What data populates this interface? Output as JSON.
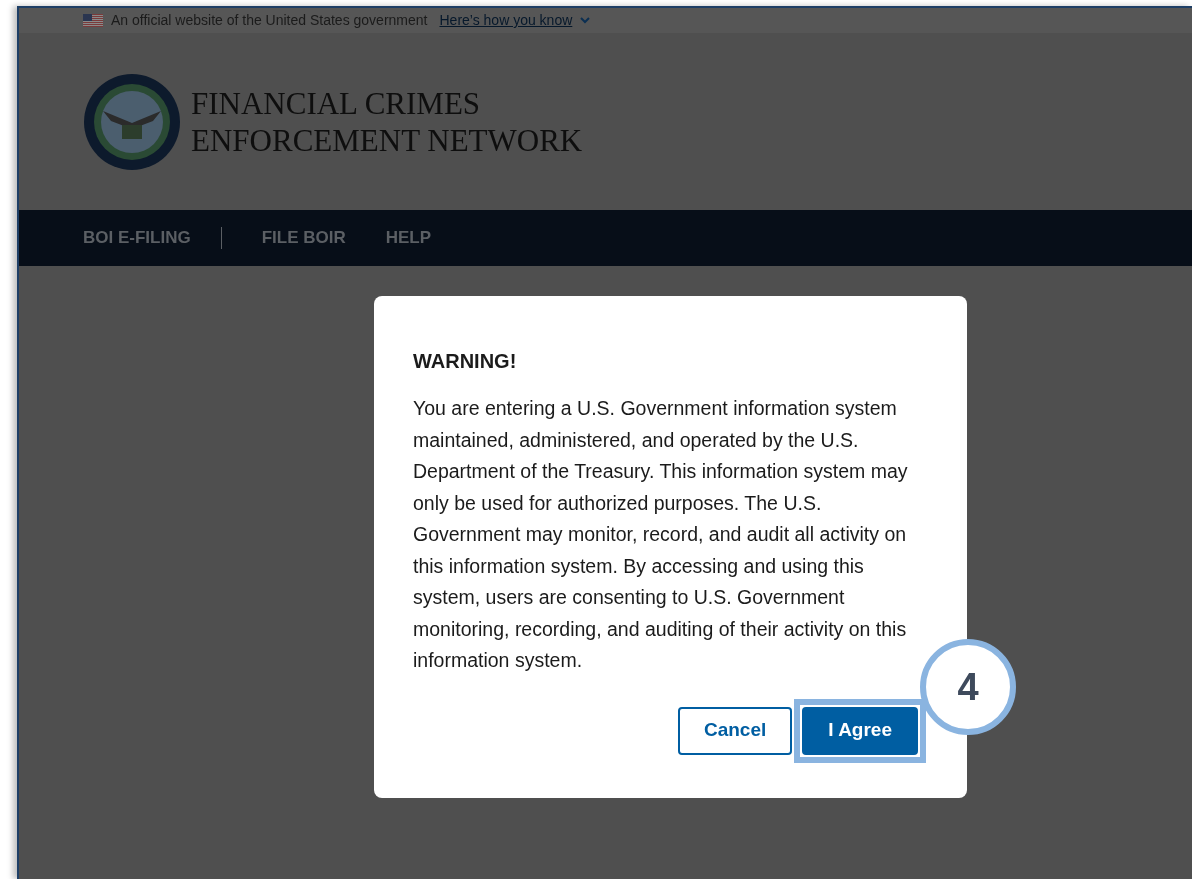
{
  "banner": {
    "text": "An official website of the United States government",
    "link": "Here’s how you know"
  },
  "header": {
    "title_lines": [
      "FINANCIAL CRIMES",
      "ENFORCEMENT NETWORK"
    ]
  },
  "nav": {
    "items": [
      {
        "label": "BOI E-FILING"
      },
      {
        "label": "FILE BOIR"
      },
      {
        "label": "HELP"
      }
    ]
  },
  "modal": {
    "title": "WARNING!",
    "body": "You are entering a U.S. Government information system maintained, administered, and operated by the U.S. Department of the Treasury. This information system may only be used for authorized purposes. The U.S. Government may monitor, record, and audit all activity on this information system. By accessing and using this system, users are consenting to U.S. Government monitoring, recording, and auditing of their activity on this information system.",
    "buttons": [
      {
        "label": "Cancel",
        "kind": "secondary"
      },
      {
        "label": "I Agree",
        "kind": "primary",
        "highlighted": true
      }
    ]
  },
  "callout": {
    "label": "4"
  }
}
